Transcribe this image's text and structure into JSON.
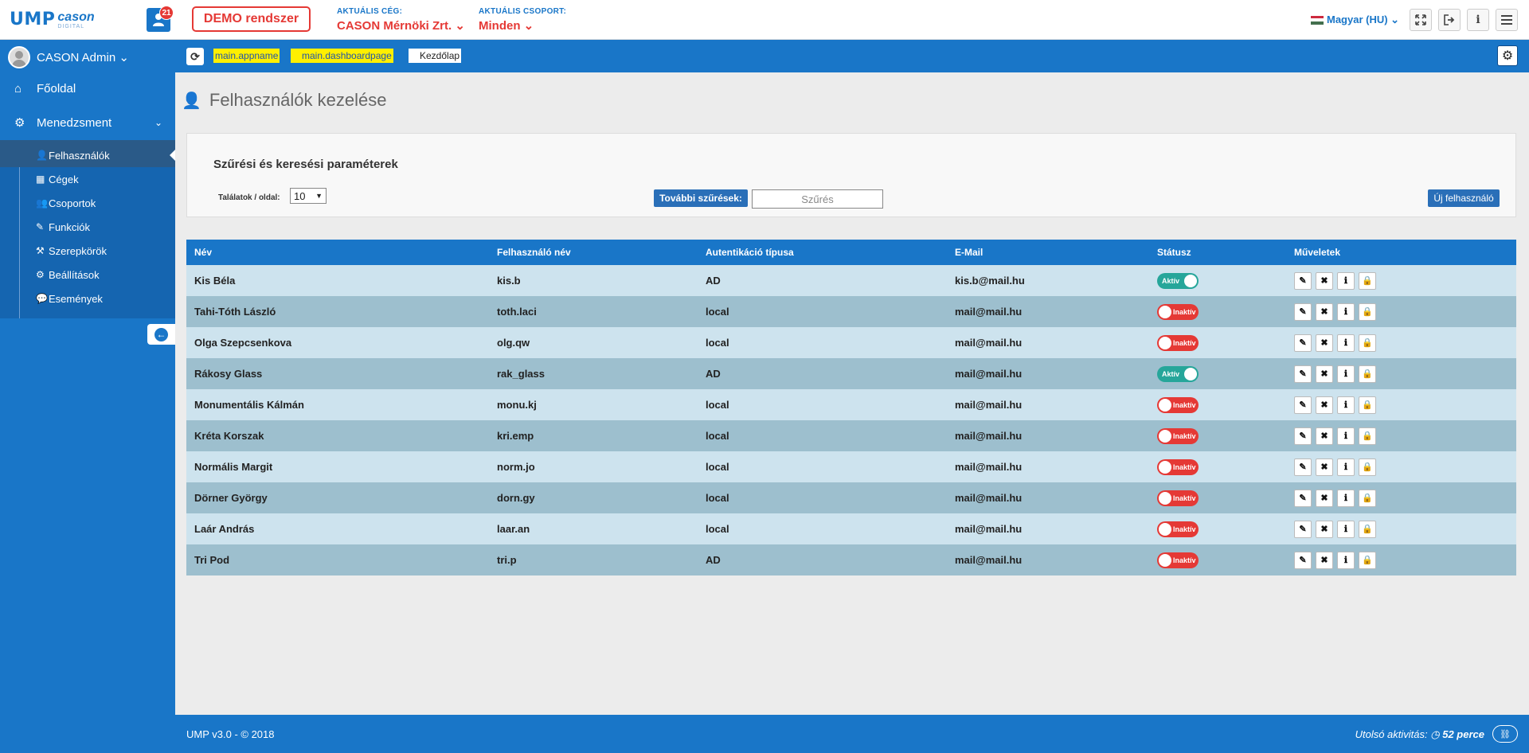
{
  "header": {
    "logo_main": "UMP",
    "logo_brand": "cason",
    "logo_sub": "DIGITAL",
    "notification_count": "21",
    "demo_label": "DEMO rendszer",
    "company_label": "AKTUÁLIS CÉG:",
    "company_value": "CASON Mérnöki Zrt. ⌄",
    "group_label": "AKTUÁLIS CSOPORT:",
    "group_value": "Minden ⌄",
    "language": "Magyar (HU) ⌄"
  },
  "sidebar": {
    "user_name": "CASON Admin ⌄",
    "home_label": "Főoldal",
    "management_label": "Menedzsment",
    "items": [
      {
        "label": "Felhasználók",
        "icon": "user-icon"
      },
      {
        "label": "Cégek",
        "icon": "building-icon"
      },
      {
        "label": "Csoportok",
        "icon": "users-icon"
      },
      {
        "label": "Funkciók",
        "icon": "edit-icon"
      },
      {
        "label": "Szerepkörök",
        "icon": "gavel-icon"
      },
      {
        "label": "Beállítások",
        "icon": "gear-icon"
      },
      {
        "label": "Események",
        "icon": "comment-icon"
      }
    ]
  },
  "breadcrumb": {
    "items": [
      "main.appname",
      "main.dashboardpage",
      "Kezdőlap"
    ]
  },
  "page": {
    "title": "Felhasználók kezelése"
  },
  "filter": {
    "title": "Szűrési és keresési paraméterek",
    "per_page_label": "Találatok / oldal:",
    "per_page_value": "10",
    "more_filters_label": "További szűrések:",
    "search_placeholder": "Szűrés",
    "new_user_label": "Új felhasználó"
  },
  "table": {
    "headers": [
      "Név",
      "Felhasználó név",
      "Autentikáció típusa",
      "E-Mail",
      "Státusz",
      "Műveletek"
    ],
    "rows": [
      {
        "name": "Kis Béla",
        "username": "kis.b",
        "auth": "AD",
        "email": "kis.b@mail.hu",
        "status": "Aktív",
        "active": true
      },
      {
        "name": "Tahi-Tóth László",
        "username": "toth.laci",
        "auth": "local",
        "email": "mail@mail.hu",
        "status": "Inaktív",
        "active": false
      },
      {
        "name": "Olga Szepcsenkova",
        "username": "olg.qw",
        "auth": "local",
        "email": "mail@mail.hu",
        "status": "Inaktív",
        "active": false
      },
      {
        "name": "Rákosy Glass",
        "username": "rak_glass",
        "auth": "AD",
        "email": "mail@mail.hu",
        "status": "Aktív",
        "active": true
      },
      {
        "name": "Monumentális Kálmán",
        "username": "monu.kj",
        "auth": "local",
        "email": "mail@mail.hu",
        "status": "Inaktív",
        "active": false
      },
      {
        "name": "Kréta Korszak",
        "username": "kri.emp",
        "auth": "local",
        "email": "mail@mail.hu",
        "status": "Inaktív",
        "active": false
      },
      {
        "name": "Normális Margit",
        "username": "norm.jo",
        "auth": "local",
        "email": "mail@mail.hu",
        "status": "Inaktív",
        "active": false
      },
      {
        "name": "Dörner György",
        "username": "dorn.gy",
        "auth": "local",
        "email": "mail@mail.hu",
        "status": "Inaktív",
        "active": false
      },
      {
        "name": "Laár András",
        "username": "laar.an",
        "auth": "local",
        "email": "mail@mail.hu",
        "status": "Inaktív",
        "active": false
      },
      {
        "name": "Tri Pod",
        "username": "tri.p",
        "auth": "AD",
        "email": "mail@mail.hu",
        "status": "Inaktív",
        "active": false
      }
    ]
  },
  "footer": {
    "version": "UMP v3.0 - © 2018",
    "activity_label": "Utolsó aktivitás:",
    "activity_value": "52 perce"
  },
  "colors": {
    "primary": "#1976c8",
    "danger": "#e53935",
    "success": "#26a69a",
    "row_odd": "#cde3ee",
    "row_even": "#9dbfce"
  }
}
